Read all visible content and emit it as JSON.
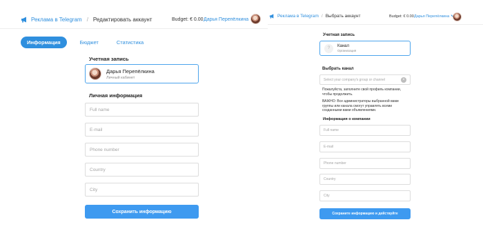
{
  "left": {
    "header": {
      "brand": "Реклама в Telegram",
      "separator": "/",
      "title": "Редактировать аккаунт",
      "budget": "Budget: € 0.00",
      "user_name": "Дарья Перепёлкина"
    },
    "tabs": [
      {
        "label": "Информация",
        "active": true
      },
      {
        "label": "Бюджет",
        "active": false
      },
      {
        "label": "Статистика",
        "active": false
      }
    ],
    "account": {
      "section_title": "Учетная запись",
      "name": "Дарья Перепёлкина",
      "subtitle": "Личный кабинет"
    },
    "personal": {
      "section_title": "Личная информация",
      "fields": [
        {
          "placeholder": "Full name"
        },
        {
          "placeholder": "E-mail"
        },
        {
          "placeholder": "Phone number"
        },
        {
          "placeholder": "Country"
        },
        {
          "placeholder": "City"
        }
      ]
    },
    "save_button": "Сохранить информацию"
  },
  "right": {
    "header": {
      "brand": "Реклама в Telegram",
      "separator": "/",
      "title": "Выбрать аккаунт",
      "budget": "Budget: € 0.00",
      "user_name": "Дарья Перепёлкина"
    },
    "account": {
      "section_title": "Учетная запись",
      "name": "Канал",
      "subtitle": "Организация"
    },
    "channel": {
      "section_title": "Выбрать канал",
      "placeholder": "Select your company's group or channel",
      "note1": "Пожалуйста, заполните свой профиль компании, чтобы продолжить.",
      "note2": "ВАЖНО: Все администраторы выбранной вами группы или канала смогут управлять всеми созданными вами объявлениями."
    },
    "company": {
      "section_title": "Информация о компании",
      "fields": [
        {
          "placeholder": "Full name"
        },
        {
          "placeholder": "E-mail"
        },
        {
          "placeholder": "Phone number"
        },
        {
          "placeholder": "Country"
        },
        {
          "placeholder": "City"
        }
      ]
    },
    "save_button": "Сохраните информацию и действуйте"
  },
  "colors": {
    "accent": "#2f8fde",
    "button": "#3e9af0",
    "card_border": "#4aa3ec"
  }
}
